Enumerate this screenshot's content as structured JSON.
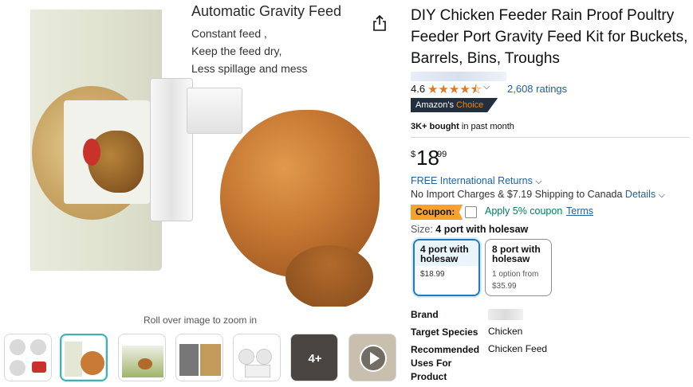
{
  "product": {
    "title": "DIY Chicken Feeder Rain Proof Poultry Feeder Port Gravity Feed Kit for Buckets, Barrels, Bins, Troughs",
    "rating": "4.6",
    "stars": "★★★★⯪",
    "ratings_count": "2,608 ratings",
    "badge_prefix": "Amazon's ",
    "badge_accent": "Choice",
    "bought_bold": "3K+ bought",
    "bought_rest": " in past month",
    "price_symbol": "$",
    "price_whole": "18",
    "price_fraction": "99"
  },
  "image": {
    "title": "Automatic Gravity Feed",
    "line1": "Constant feed ,",
    "line2": "Keep the feed dry,",
    "line3": "Less spillage and mess",
    "zoom_hint": "Roll over image to zoom in",
    "more_count": "4+"
  },
  "delivery": {
    "returns": "FREE International Returns",
    "shipping_text": "No Import Charges & $7.19 Shipping to Canada ",
    "details_link": "Details"
  },
  "coupon": {
    "badge": "Coupon:",
    "text": "Apply 5% coupon",
    "terms": "Terms"
  },
  "size": {
    "label": "Size: ",
    "selected": "4 port with holesaw",
    "options": [
      {
        "name": "4 port with holesaw",
        "price": "$18.99"
      },
      {
        "name": "8 port with holesaw",
        "sub": "1 option from",
        "price": "$35.99"
      }
    ]
  },
  "specs": {
    "brand_label": "Brand",
    "species_label": "Target Species",
    "species_value": "Chicken",
    "uses_label": "Recommended Uses For Product",
    "uses_value": "Chicken Feed"
  },
  "colors": {
    "star": "#de7921",
    "link": "#2162a1",
    "coupon_bg": "#f7a22b",
    "coupon_text": "#067d62",
    "selected_border": "#1e78c2",
    "badge_bg": "#232f3e",
    "badge_accent": "#f08804"
  },
  "icons": [
    "share-icon",
    "chevron-down-icon",
    "play-icon",
    "checkbox-icon"
  ]
}
